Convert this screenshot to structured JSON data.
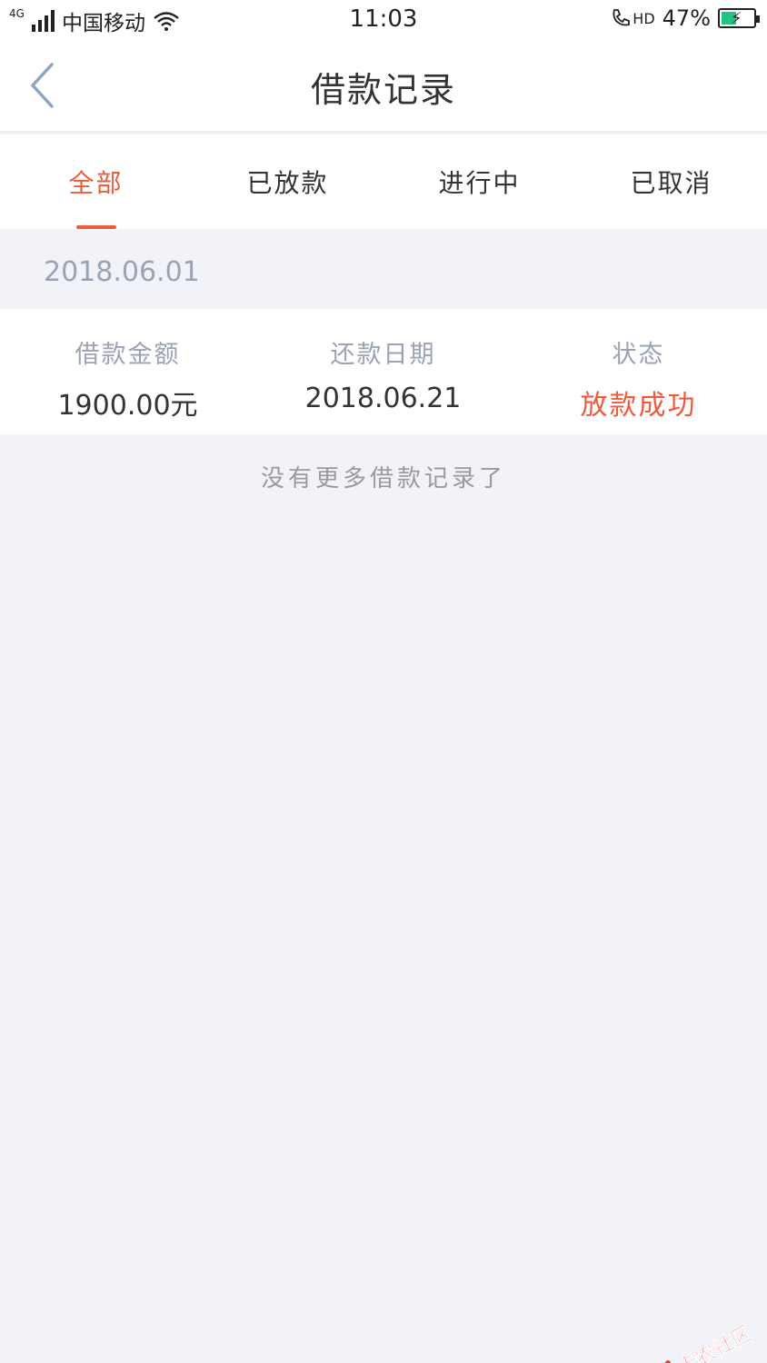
{
  "status_bar": {
    "network": "4G",
    "carrier": "中国移动",
    "time": "11:03",
    "hd": "HD",
    "battery_percent": "47%",
    "battery_level": 0.47
  },
  "nav": {
    "title": "借款记录"
  },
  "tabs": [
    {
      "label": "全部",
      "active": true
    },
    {
      "label": "已放款",
      "active": false
    },
    {
      "label": "进行中",
      "active": false
    },
    {
      "label": "已取消",
      "active": false
    }
  ],
  "records": [
    {
      "date": "2018.06.01",
      "amount_label": "借款金额",
      "amount": "1900.00元",
      "repay_label": "还款日期",
      "repay_date": "2018.06.21",
      "status_label": "状态",
      "status": "放款成功"
    }
  ],
  "footer": {
    "no_more": "没有更多借款记录了"
  },
  "watermark": {
    "text": "卡农社区"
  },
  "colors": {
    "accent": "#ef5a3b",
    "muted": "#9aa3b5",
    "background": "#f2f3f8"
  }
}
